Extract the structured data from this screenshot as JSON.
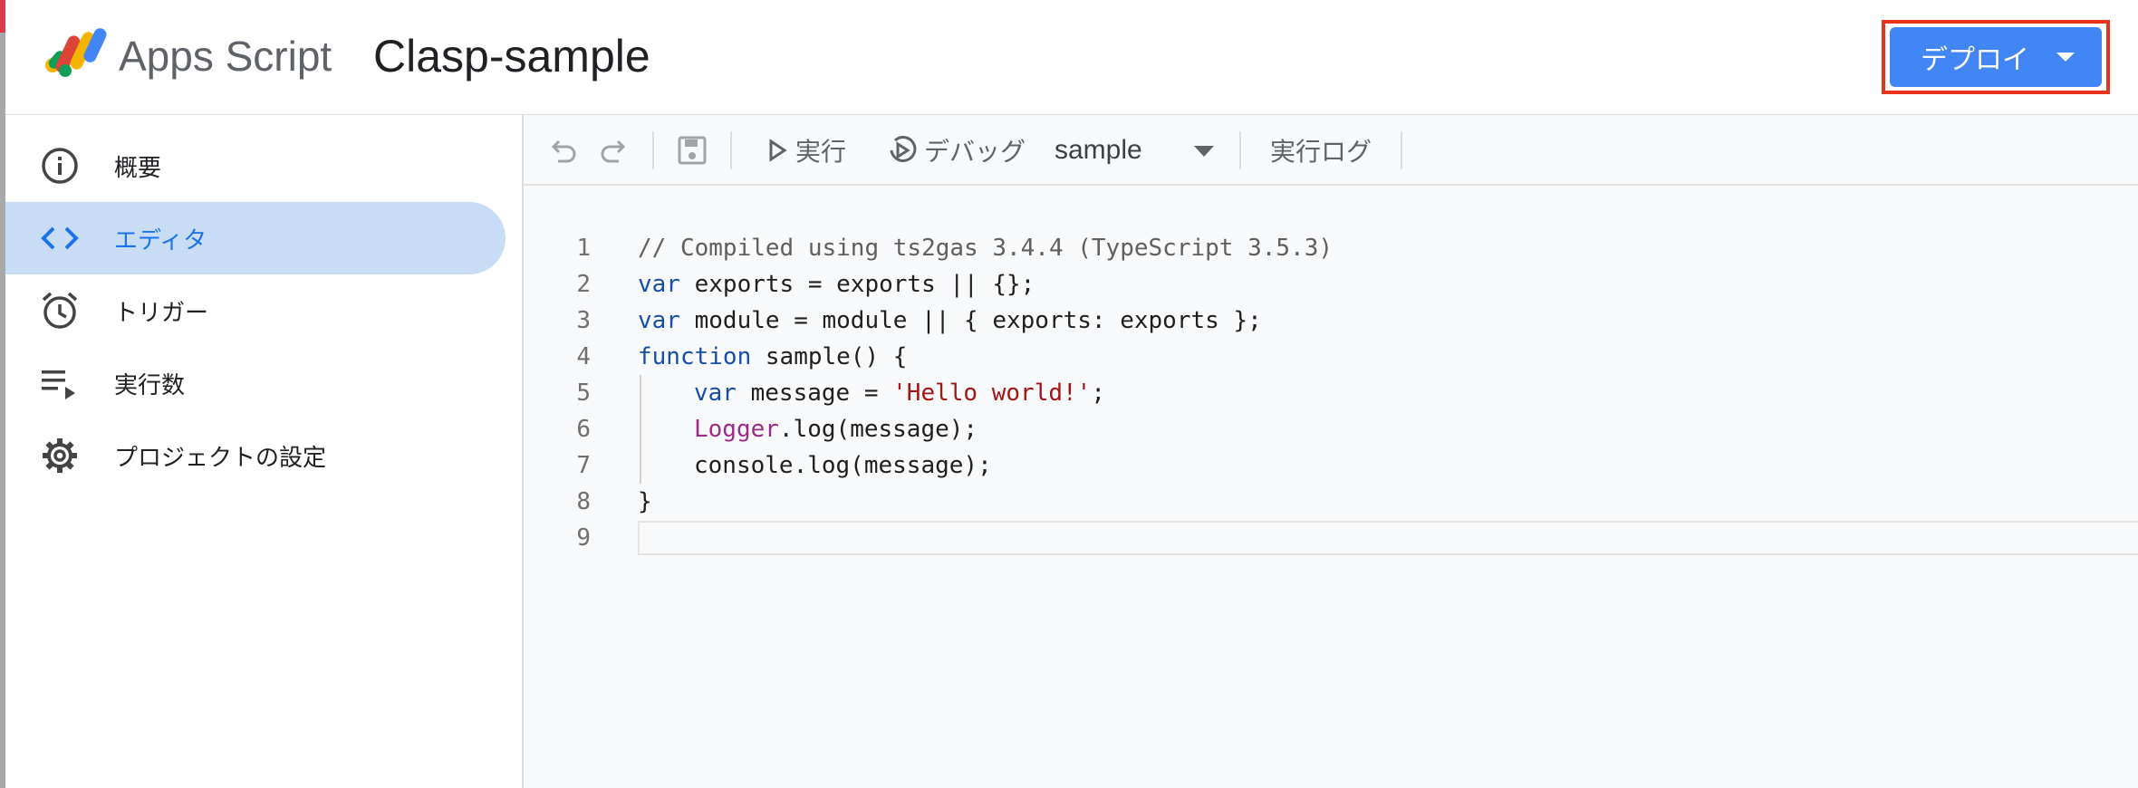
{
  "header": {
    "app_name": "Apps Script",
    "project_name": "Clasp-sample",
    "deploy_label": "デプロイ"
  },
  "sidebar": {
    "items": [
      {
        "label": "概要",
        "icon": "info-icon"
      },
      {
        "label": "エディタ",
        "icon": "code-icon",
        "active": true
      },
      {
        "label": "トリガー",
        "icon": "alarm-clock-icon"
      },
      {
        "label": "実行数",
        "icon": "playlist-play-icon"
      },
      {
        "label": "プロジェクトの設定",
        "icon": "gear-icon"
      }
    ]
  },
  "toolbar": {
    "run_label": "実行",
    "debug_label": "デバッグ",
    "function_name": "sample",
    "log_label": "実行ログ"
  },
  "colors": {
    "accent": "#4285f4",
    "highlight_outline": "#e8331d",
    "active_nav_bg": "#c9dcf5",
    "active_nav_text": "#1a73e8"
  },
  "code": {
    "line_numbers": [
      "1",
      "2",
      "3",
      "4",
      "5",
      "6",
      "7",
      "8",
      "9"
    ],
    "l1_comment": "// Compiled using ts2gas 3.4.4 (TypeScript 3.5.3)",
    "l2_kw": "var",
    "l2_rest": " exports = exports || {};",
    "l3_kw": "var",
    "l3_rest": " module = module || { exports: exports };",
    "l4_kw": "function",
    "l4_rest": " sample() {",
    "l5_kw": "var",
    "l5_mid": " message = ",
    "l5_str": "'Hello world!'",
    "l5_end": ";",
    "l6_cls": "Logger",
    "l6_rest": ".log(message);",
    "l7_text": "console.log(message);",
    "l8_text": "}"
  }
}
